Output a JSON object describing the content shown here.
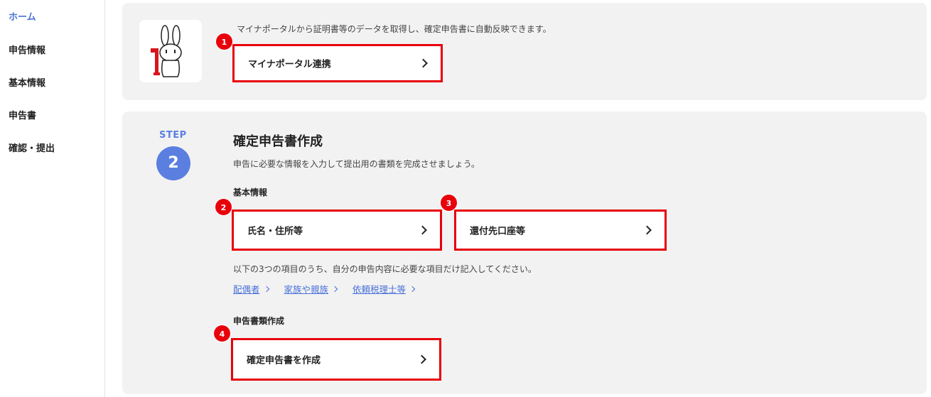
{
  "sidebar": {
    "items": [
      {
        "label": "ホーム",
        "active": true
      },
      {
        "label": "申告情報"
      },
      {
        "label": "基本情報"
      },
      {
        "label": "申告書"
      },
      {
        "label": "確認・提出"
      }
    ]
  },
  "mynaportal": {
    "description": "マイナポータルから証明書等のデータを取得し、確定申告書に自動反映できます。",
    "button_label": "マイナポータル連携",
    "badge": "1"
  },
  "step2": {
    "step_label": "STEP",
    "step_number": "2",
    "title": "確定申告書作成",
    "description": "申告に必要な情報を入力して提出用の書類を完成させましょう。",
    "basic_heading": "基本情報",
    "buttons": [
      {
        "label": "氏名・住所等",
        "badge": "2"
      },
      {
        "label": "還付先口座等",
        "badge": "3"
      }
    ],
    "optional_description": "以下の3つの項目のうち、自分の申告内容に必要な項目だけ記入してください。",
    "links": [
      {
        "label": "配偶者"
      },
      {
        "label": "家族や親族"
      },
      {
        "label": "依頼税理士等"
      }
    ],
    "docs_heading": "申告書類作成",
    "create_button": {
      "label": "確定申告書を作成",
      "badge": "4"
    }
  },
  "colors": {
    "accent": "#5b7fe0",
    "link": "#4a72d8",
    "highlight": "#e8000b",
    "card_bg": "#f2f2f2"
  }
}
